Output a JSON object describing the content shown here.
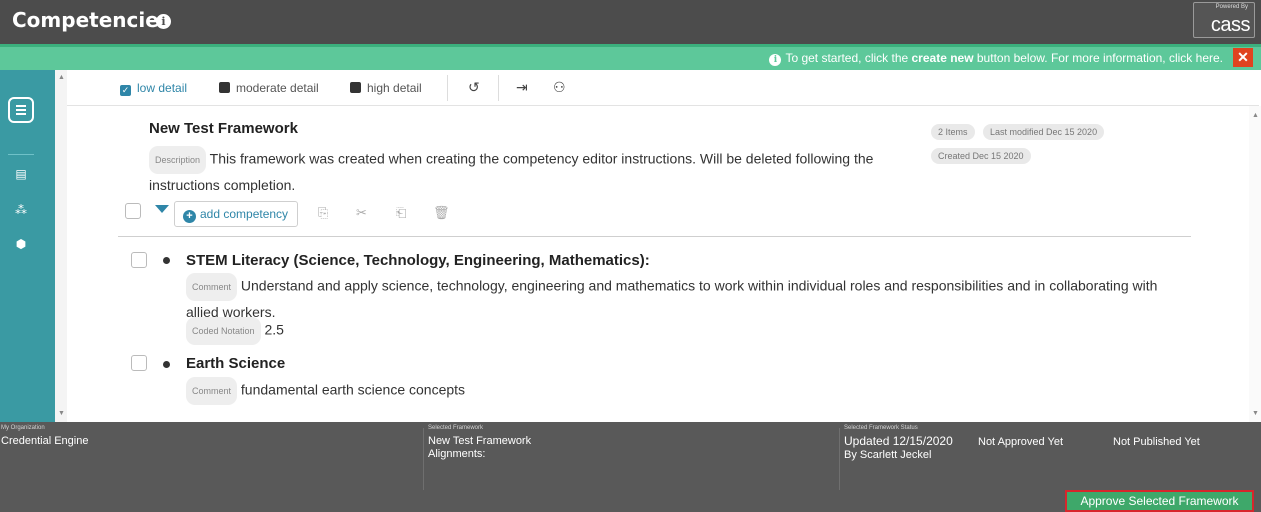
{
  "header": {
    "title": "Competencies",
    "info_icon": "info-icon",
    "logo": {
      "powered_by": "Powered By",
      "name": "cass"
    }
  },
  "banner": {
    "text_before": "To get started, click the ",
    "text_bold": "create new",
    "text_after": " button below. For more information, click here.",
    "close_label": "x",
    "color": "#5dc89a"
  },
  "sidebar": {
    "color": "#3a9aa3",
    "items": [
      {
        "icon": "menu-icon"
      },
      {
        "icon": "list-icon"
      },
      {
        "icon": "hierarchy-icon"
      },
      {
        "icon": "cube-icon"
      }
    ]
  },
  "toolbar": {
    "detail_options": [
      {
        "label": "low detail",
        "checked": true
      },
      {
        "label": "moderate detail",
        "checked": false
      },
      {
        "label": "high detail",
        "checked": false
      }
    ],
    "icons": [
      "undo-icon",
      "export-icon",
      "users-icon"
    ]
  },
  "framework": {
    "title": "New Test Framework",
    "description_tag": "Description",
    "description": "This framework was created when creating the competency editor instructions. Will be deleted following the instructions completion.",
    "items_badge": "2 Items",
    "last_modified": "Last modified Dec 15 2020",
    "created": "Created Dec 15 2020",
    "add_competency_label": "add competency"
  },
  "competencies": [
    {
      "title": "STEM Literacy (Science, Technology, Engineering, Mathematics):",
      "comment_tag": "Comment",
      "comment": "Understand and apply science, technology, engineering and mathematics to work within individual roles and responsibilities and in collaborating with allied workers.",
      "coded_tag": "Coded Notation",
      "coded_value": "2.5"
    },
    {
      "title": "Earth Science",
      "comment_tag": "Comment",
      "comment": "fundamental earth science concepts"
    }
  ],
  "footer": {
    "org_label": "My Organization",
    "org_value": "Credential Engine",
    "framework_label": "Selected Framework",
    "framework_value": "New Test Framework",
    "alignments": "Alignments:",
    "status_label": "Selected Framework Status",
    "updated": "Updated 12/15/2020",
    "updated_by": "By Scarlett Jeckel",
    "approval": "Not Approved Yet",
    "published": "Not Published Yet",
    "approve_button": "Approve Selected Framework"
  }
}
